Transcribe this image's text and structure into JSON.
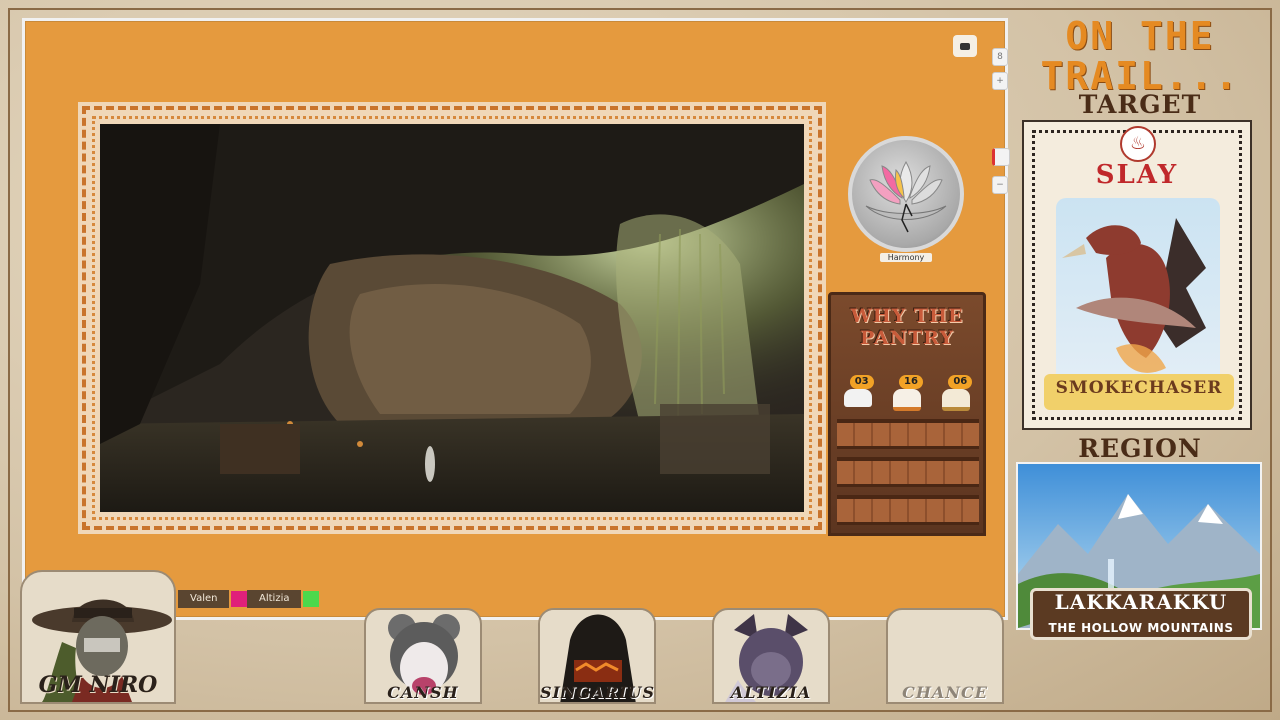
{
  "overlay": {
    "title": "ON THE TRAIL...",
    "target_heading": "TARGET",
    "target_action": "SLAY",
    "target_name": "SMOKECHASER",
    "region_heading": "REGION",
    "region_name": "LAKKARAKKU",
    "region_subtitle": "THE HOLLOW MOUNTAINS"
  },
  "harmony": {
    "label": "Harmony"
  },
  "pantry": {
    "title_line1": "WHY THE",
    "title_line2": "PANTRY",
    "items": [
      {
        "count": "03",
        "icon": "cloud-food-icon"
      },
      {
        "count": "16",
        "icon": "meat-food-icon"
      },
      {
        "count": "06",
        "icon": "grain-food-icon"
      }
    ]
  },
  "legend": [
    {
      "name": "Valen",
      "color": "#e0207a"
    },
    {
      "name": "Altizia",
      "color": "#4cd84c"
    }
  ],
  "cast": {
    "gm": "GM NIRO",
    "players": [
      "CANSH",
      "SINGARIUS",
      "ALTIZIA",
      "CHANCE"
    ]
  },
  "canvas_controls": {
    "zoom_hint": "8"
  }
}
